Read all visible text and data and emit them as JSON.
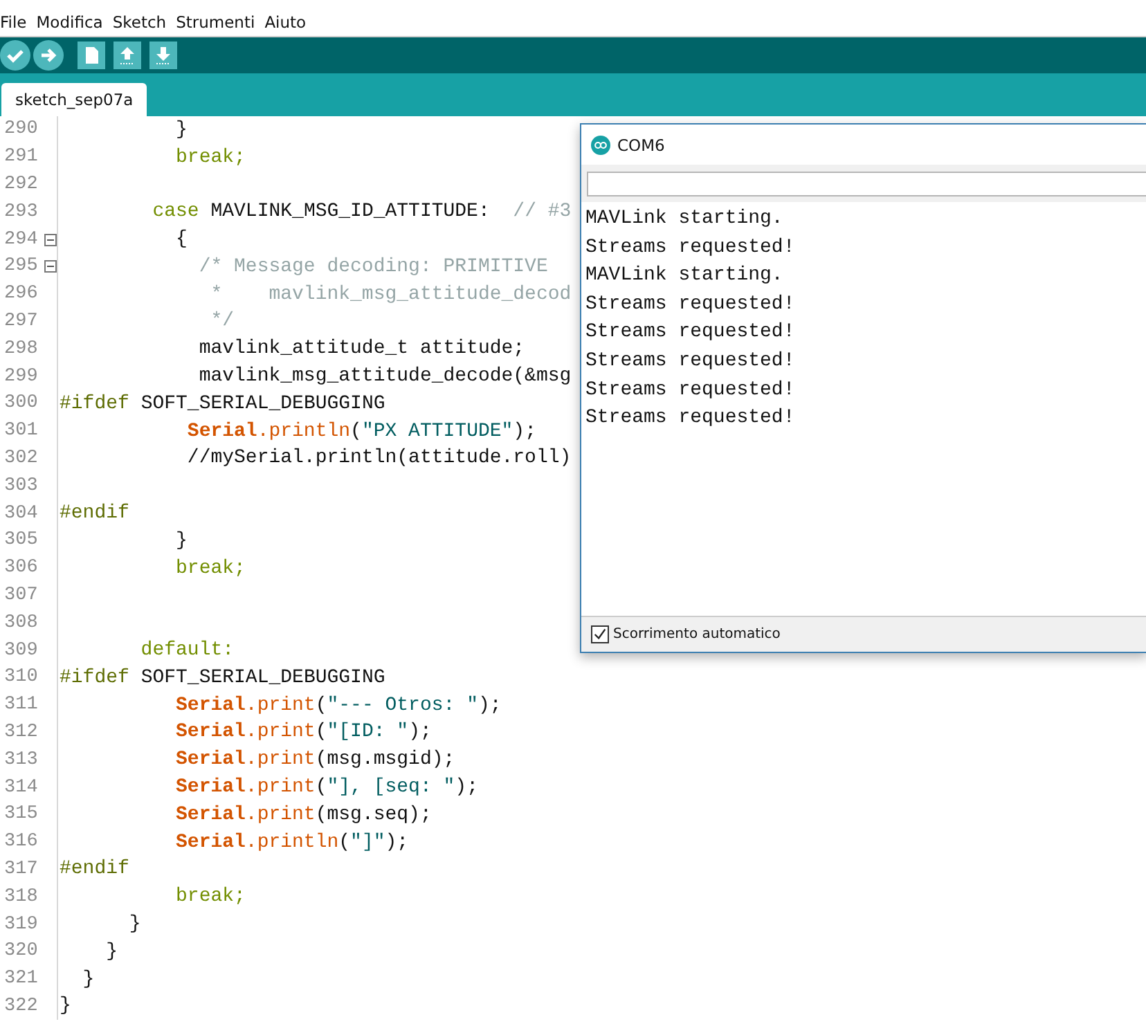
{
  "menu": [
    "File",
    "Modifica",
    "Sketch",
    "Strumenti",
    "Aiuto"
  ],
  "tabs": [
    {
      "label": "sketch_sep07a",
      "selected": true
    }
  ],
  "editor": {
    "lines": [
      {
        "number": "290",
        "foldable": false,
        "tokens": [
          {
            "kind": "plain",
            "text": "          }"
          }
        ]
      },
      {
        "number": "291",
        "foldable": false,
        "tokens": [
          {
            "kind": "keyword",
            "text": "          break;"
          }
        ]
      },
      {
        "number": "292",
        "foldable": false
      },
      {
        "number": "293",
        "foldable": false,
        "tokens": [
          {
            "kind": "keyword",
            "text": "        case"
          },
          {
            "kind": "plain",
            "text": " MAVLINK_MSG_ID_ATTITUDE:  "
          },
          {
            "kind": "comment",
            "text": "// #3"
          }
        ]
      },
      {
        "number": "294",
        "foldable": true,
        "tokens": [
          {
            "kind": "plain",
            "text": "          {"
          }
        ]
      },
      {
        "number": "295",
        "foldable": true,
        "tokens": [
          {
            "kind": "comment",
            "text": "            /* Message decoding: PRIMITIVE"
          }
        ]
      },
      {
        "number": "296",
        "foldable": false,
        "tokens": [
          {
            "kind": "comment",
            "text": "             *    mavlink_msg_attitude_decod"
          }
        ]
      },
      {
        "number": "297",
        "foldable": false,
        "tokens": [
          {
            "kind": "comment",
            "text": "             */"
          }
        ]
      },
      {
        "number": "298",
        "foldable": false,
        "tokens": [
          {
            "kind": "plain",
            "text": "            mavlink_attitude_t attitude;"
          }
        ]
      },
      {
        "number": "299",
        "foldable": false,
        "tokens": [
          {
            "kind": "plain",
            "text": "            mavlink_msg_attitude_decode(&msg"
          }
        ]
      },
      {
        "number": "300",
        "foldable": false,
        "tokens": [
          {
            "kind": "preproc",
            "text": "#ifdef"
          },
          {
            "kind": "plain",
            "text": " SOFT_SERIAL_DEBUGGING"
          }
        ]
      },
      {
        "number": "301",
        "foldable": false,
        "tokens": [
          {
            "kind": "serial",
            "text": "           Serial"
          },
          {
            "kind": "method",
            "text": ".println"
          },
          {
            "kind": "plain",
            "text": "("
          },
          {
            "kind": "string",
            "text": "\"PX ATTITUDE\""
          },
          {
            "kind": "plain",
            "text": ");"
          }
        ]
      },
      {
        "number": "302",
        "foldable": false,
        "tokens": [
          {
            "kind": "plain",
            "text": "           //mySerial.println(attitude.roll)"
          }
        ]
      },
      {
        "number": "303",
        "foldable": false
      },
      {
        "number": "304",
        "foldable": false,
        "tokens": [
          {
            "kind": "preproc",
            "text": "#endif"
          }
        ]
      },
      {
        "number": "305",
        "foldable": false,
        "tokens": [
          {
            "kind": "plain",
            "text": "          }"
          }
        ]
      },
      {
        "number": "306",
        "foldable": false,
        "tokens": [
          {
            "kind": "keyword",
            "text": "          break;"
          }
        ]
      },
      {
        "number": "307",
        "foldable": false
      },
      {
        "number": "308",
        "foldable": false
      },
      {
        "number": "309",
        "foldable": false,
        "tokens": [
          {
            "kind": "keyword",
            "text": "       default:"
          }
        ]
      },
      {
        "number": "310",
        "foldable": false,
        "tokens": [
          {
            "kind": "preproc",
            "text": "#ifdef"
          },
          {
            "kind": "plain",
            "text": " SOFT_SERIAL_DEBUGGING"
          }
        ]
      },
      {
        "number": "311",
        "foldable": false,
        "tokens": [
          {
            "kind": "serial",
            "text": "          Serial"
          },
          {
            "kind": "method",
            "text": ".print"
          },
          {
            "kind": "plain",
            "text": "("
          },
          {
            "kind": "string",
            "text": "\"--- Otros: \""
          },
          {
            "kind": "plain",
            "text": ");"
          }
        ]
      },
      {
        "number": "312",
        "foldable": false,
        "tokens": [
          {
            "kind": "serial",
            "text": "          Serial"
          },
          {
            "kind": "method",
            "text": ".print"
          },
          {
            "kind": "plain",
            "text": "("
          },
          {
            "kind": "string",
            "text": "\"[ID: \""
          },
          {
            "kind": "plain",
            "text": ");"
          }
        ]
      },
      {
        "number": "313",
        "foldable": false,
        "tokens": [
          {
            "kind": "serial",
            "text": "          Serial"
          },
          {
            "kind": "method",
            "text": ".print"
          },
          {
            "kind": "plain",
            "text": "(msg.msgid);"
          }
        ]
      },
      {
        "number": "314",
        "foldable": false,
        "tokens": [
          {
            "kind": "serial",
            "text": "          Serial"
          },
          {
            "kind": "method",
            "text": ".print"
          },
          {
            "kind": "plain",
            "text": "("
          },
          {
            "kind": "string",
            "text": "\"], [seq: \""
          },
          {
            "kind": "plain",
            "text": ");"
          }
        ]
      },
      {
        "number": "315",
        "foldable": false,
        "tokens": [
          {
            "kind": "serial",
            "text": "          Serial"
          },
          {
            "kind": "method",
            "text": ".print"
          },
          {
            "kind": "plain",
            "text": "(msg.seq);"
          }
        ]
      },
      {
        "number": "316",
        "foldable": false,
        "tokens": [
          {
            "kind": "serial",
            "text": "          Serial"
          },
          {
            "kind": "method",
            "text": ".println"
          },
          {
            "kind": "plain",
            "text": "("
          },
          {
            "kind": "string",
            "text": "\"]\""
          },
          {
            "kind": "plain",
            "text": ");"
          }
        ]
      },
      {
        "number": "317",
        "foldable": false,
        "tokens": [
          {
            "kind": "preproc",
            "text": "#endif"
          }
        ]
      },
      {
        "number": "318",
        "foldable": false,
        "tokens": [
          {
            "kind": "keyword",
            "text": "          break;"
          }
        ]
      },
      {
        "number": "319",
        "foldable": false,
        "tokens": [
          {
            "kind": "plain",
            "text": "      }"
          }
        ]
      },
      {
        "number": "320",
        "foldable": false,
        "tokens": [
          {
            "kind": "plain",
            "text": "    }"
          }
        ]
      },
      {
        "number": "321",
        "foldable": false,
        "tokens": [
          {
            "kind": "plain",
            "text": "  }"
          }
        ]
      },
      {
        "number": "322",
        "foldable": false,
        "tokens": [
          {
            "kind": "plain",
            "text": "}"
          }
        ]
      }
    ]
  },
  "serial_monitor": {
    "title": "COM6",
    "output": [
      "MAVLink starting.",
      "Streams requested!",
      "MAVLink starting.",
      "Streams requested!",
      "Streams requested!",
      "Streams requested!",
      "Streams requested!",
      "Streams requested!"
    ],
    "autoscroll": {
      "label": "Scorrimento automatico",
      "checked": true
    }
  }
}
